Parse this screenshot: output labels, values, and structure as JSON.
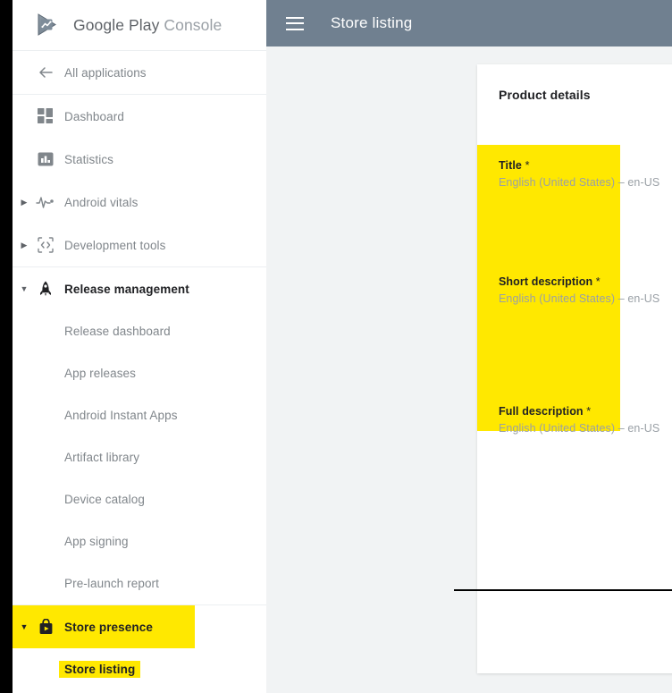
{
  "brand": {
    "name_bold": "Google Play",
    "name_light": " Console",
    "logo_icon": "google-play-logo-icon"
  },
  "header": {
    "menu_icon": "hamburger-menu-icon",
    "title": "Store listing"
  },
  "sidebar": {
    "back_item": {
      "label": "All applications",
      "icon": "arrow-left-icon"
    },
    "items": [
      {
        "label": "Dashboard",
        "icon": "dashboard-grid-icon",
        "caret": "",
        "highlighted": false
      },
      {
        "label": "Statistics",
        "icon": "bar-chart-icon",
        "caret": "",
        "highlighted": false
      },
      {
        "label": "Android vitals",
        "icon": "pulse-heartbeat-icon",
        "caret": "▶",
        "highlighted": false
      },
      {
        "label": "Development tools",
        "icon": "code-brackets-phone-icon",
        "caret": "▶",
        "highlighted": false
      }
    ],
    "release_management": {
      "label": "Release management",
      "icon": "rocket-icon",
      "caret": "▼",
      "children": [
        {
          "label": "Release dashboard"
        },
        {
          "label": "App releases"
        },
        {
          "label": "Android Instant Apps"
        },
        {
          "label": "Artifact library"
        },
        {
          "label": "Device catalog"
        },
        {
          "label": "App signing"
        },
        {
          "label": "Pre-launch report"
        }
      ]
    },
    "store_presence": {
      "label": "Store presence",
      "icon": "shopping-bag-play-icon",
      "caret": "▼",
      "highlighted": true,
      "children": [
        {
          "label": "Store listing",
          "highlighted": true
        }
      ]
    }
  },
  "main": {
    "card_title": "Product details",
    "fields": [
      {
        "label": "Title",
        "required_marker": "*",
        "locale": "English (United States)",
        "separator": "–",
        "locale_code": "en-US"
      },
      {
        "label": "Short description",
        "required_marker": "*",
        "locale": "English (United States)",
        "separator": "–",
        "locale_code": "en-US"
      },
      {
        "label": "Full description",
        "required_marker": "*",
        "locale": "English (United States)",
        "separator": "–",
        "locale_code": "en-US"
      }
    ]
  },
  "colors": {
    "header_bg": "#708090",
    "highlight": "#ffe800",
    "content_bg": "#f1f3f4",
    "label_text": "#80868b",
    "active_text": "#202124"
  }
}
